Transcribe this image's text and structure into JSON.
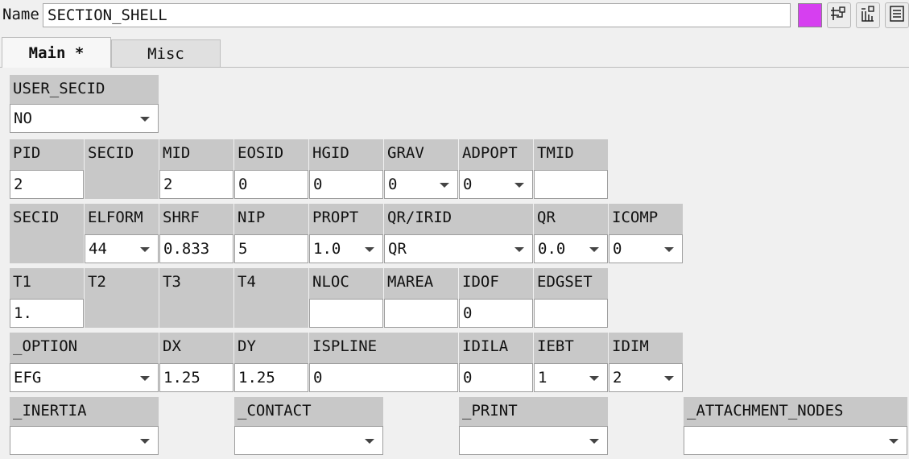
{
  "header": {
    "name_label": "Name",
    "name_value": "SECTION_SHELL",
    "swatch_color": "#d63ff0",
    "buttons": [
      "pick-node-icon",
      "pick-tree-icon",
      "list-menu-icon"
    ]
  },
  "tabs": [
    {
      "label": "Main *",
      "active": true
    },
    {
      "label": "Misc",
      "active": false
    }
  ],
  "fields": {
    "user_secid": {
      "label": "USER_SECID",
      "value": "NO"
    },
    "row1": {
      "pid": {
        "label": "PID",
        "value": "2"
      },
      "secid": {
        "label": "SECID"
      },
      "mid": {
        "label": "MID",
        "value": "2"
      },
      "eosid": {
        "label": "EOSID",
        "value": "0"
      },
      "hgid": {
        "label": "HGID",
        "value": "0"
      },
      "grav": {
        "label": "GRAV",
        "value": "0"
      },
      "adpopt": {
        "label": "ADPOPT",
        "value": "0"
      },
      "tmid": {
        "label": "TMID",
        "value": ""
      }
    },
    "row2": {
      "secid": {
        "label": "SECID"
      },
      "elform": {
        "label": "ELFORM",
        "value": "44"
      },
      "shrf": {
        "label": "SHRF",
        "value": "0.833"
      },
      "nip": {
        "label": "NIP",
        "value": "5"
      },
      "propt": {
        "label": "PROPT",
        "value": "1.0"
      },
      "qr_irid": {
        "label": "QR/IRID",
        "value": "QR"
      },
      "qr": {
        "label": "QR",
        "value": "0.0"
      },
      "icomp": {
        "label": "ICOMP",
        "value": "0"
      }
    },
    "row3": {
      "t1": {
        "label": "T1",
        "value": "1."
      },
      "t2": {
        "label": "T2"
      },
      "t3": {
        "label": "T3"
      },
      "t4": {
        "label": "T4"
      },
      "nloc": {
        "label": "NLOC",
        "value": ""
      },
      "marea": {
        "label": "MAREA",
        "value": ""
      },
      "idof": {
        "label": "IDOF",
        "value": "0"
      },
      "edgset": {
        "label": "EDGSET",
        "value": ""
      }
    },
    "row4": {
      "option": {
        "label": "_OPTION",
        "value": "EFG"
      },
      "dx": {
        "label": "DX",
        "value": "1.25"
      },
      "dy": {
        "label": "DY",
        "value": "1.25"
      },
      "ispline": {
        "label": "ISPLINE",
        "value": "0"
      },
      "idila": {
        "label": "IDILA",
        "value": "0"
      },
      "iebt": {
        "label": "IEBT",
        "value": "1"
      },
      "idim": {
        "label": "IDIM",
        "value": "2"
      }
    },
    "row5": {
      "inertia": {
        "label": "_INERTIA",
        "value": ""
      },
      "contact": {
        "label": "_CONTACT",
        "value": ""
      },
      "print": {
        "label": "_PRINT",
        "value": ""
      },
      "attachment_nodes": {
        "label": "_ATTACHMENT_NODES",
        "value": ""
      }
    }
  }
}
